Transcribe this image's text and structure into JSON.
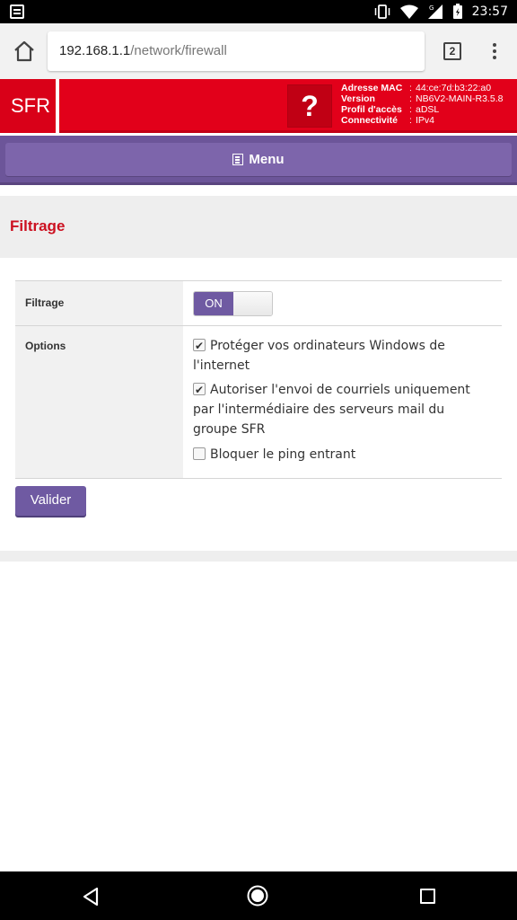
{
  "status_bar": {
    "time": "23:57",
    "icons": [
      "notification-icon",
      "vibrate-icon",
      "wifi-icon",
      "signal-icon",
      "battery-icon"
    ]
  },
  "browser": {
    "url_host": "192.168.1.1",
    "url_path": "/network/firewall",
    "tab_count": "2",
    "icons": [
      "home-icon",
      "kebab-menu-icon"
    ]
  },
  "header": {
    "logo": "SFR",
    "help": "?",
    "info": [
      {
        "key": "Adresse MAC",
        "value": "44:ce:7d:b3:22:a0"
      },
      {
        "key": "Version",
        "value": "NB6V2-MAIN-R3.5.8"
      },
      {
        "key": "Profil d'accès",
        "value": "aDSL"
      },
      {
        "key": "Connectivité",
        "value": "IPv4"
      }
    ],
    "separator": ":",
    "colors": {
      "brand_red": "#e2001a",
      "menu_purple": "#6c5599"
    }
  },
  "menu": {
    "label": "Menu"
  },
  "page": {
    "title": "Filtrage",
    "title_color": "#cc1020"
  },
  "form": {
    "filter_label": "Filtrage",
    "toggle_on": "ON",
    "options_label": "Options",
    "options": [
      {
        "label": "Protéger vos ordinateurs Windows de l'internet",
        "checked": true
      },
      {
        "label": "Autoriser l'envoi de courriels uniquement par l'intermédiaire des serveurs mail du groupe SFR",
        "checked": true
      },
      {
        "label": "Bloquer le ping entrant",
        "checked": false
      }
    ],
    "submit_label": "Valider"
  },
  "nav_bar": {
    "icons": [
      "back-icon",
      "home-circle-icon",
      "recents-icon"
    ]
  }
}
